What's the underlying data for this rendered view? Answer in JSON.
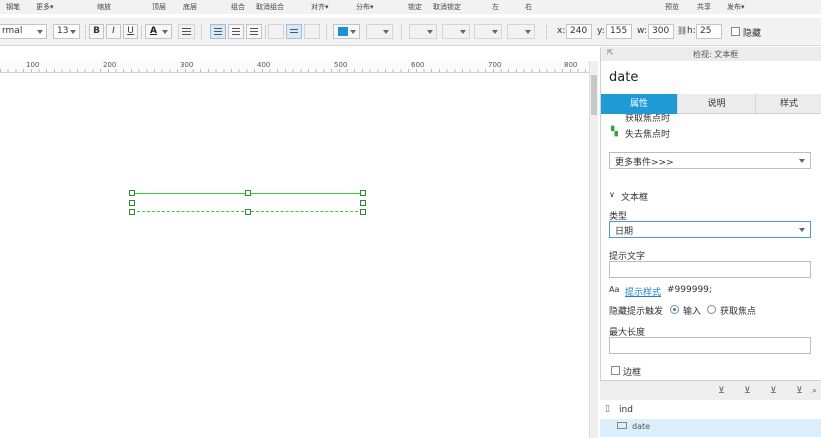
{
  "menu_strip": {
    "items": [
      "钢笔",
      "更多▾",
      "缩放",
      "顶层",
      "底层",
      "组合",
      "取消组合",
      "对齐▾",
      "分布▾",
      "锁定",
      "取消锁定",
      "左",
      "右",
      "预览",
      "共享",
      "发布▾"
    ]
  },
  "toolbar": {
    "font_name": "rmal",
    "font_size": "13",
    "bold_label": "B",
    "italic_label": "I",
    "underline_label": "U",
    "font_color_label": "A",
    "font_color": "#222222",
    "fill_color": "#1e90d6",
    "x_label": "x:",
    "x_value": "240",
    "y_label": "y:",
    "y_value": "155",
    "w_label": "w:",
    "w_value": "300",
    "h_label": "h:",
    "h_value": "25",
    "hide_label": "隐藏"
  },
  "ruler": {
    "ticks": [
      "100",
      "200",
      "300",
      "400",
      "500",
      "600",
      "700",
      "800"
    ]
  },
  "inspector": {
    "header_title": "检视: 文本框",
    "widget_name": "date",
    "tabs": [
      {
        "label": "属性"
      },
      {
        "label": "说明"
      },
      {
        "label": "样式"
      }
    ],
    "events": [
      {
        "label": "获取焦点时"
      },
      {
        "label": "失去焦点时"
      }
    ],
    "more_events": "更多事件>>>",
    "section_title": "文本框",
    "type_label": "类型",
    "type_value": "日期",
    "hint_text_label": "提示文字",
    "hint_text_value": "",
    "hint_style_prefix": "Aa",
    "hint_style_link": "提示样式",
    "hint_style_color": "#999999;",
    "hide_trigger_label": "隐藏提示触发",
    "hide_trigger_options": [
      "输入",
      "获取焦点"
    ],
    "max_length_label": "最大长度",
    "max_length_value": "",
    "border_checkbox_label": "边框"
  },
  "outline": {
    "page_name": "ind",
    "widget_row": "date"
  },
  "colors": {
    "accent": "#1e9bd7",
    "selection_green": "#3ec63e"
  }
}
